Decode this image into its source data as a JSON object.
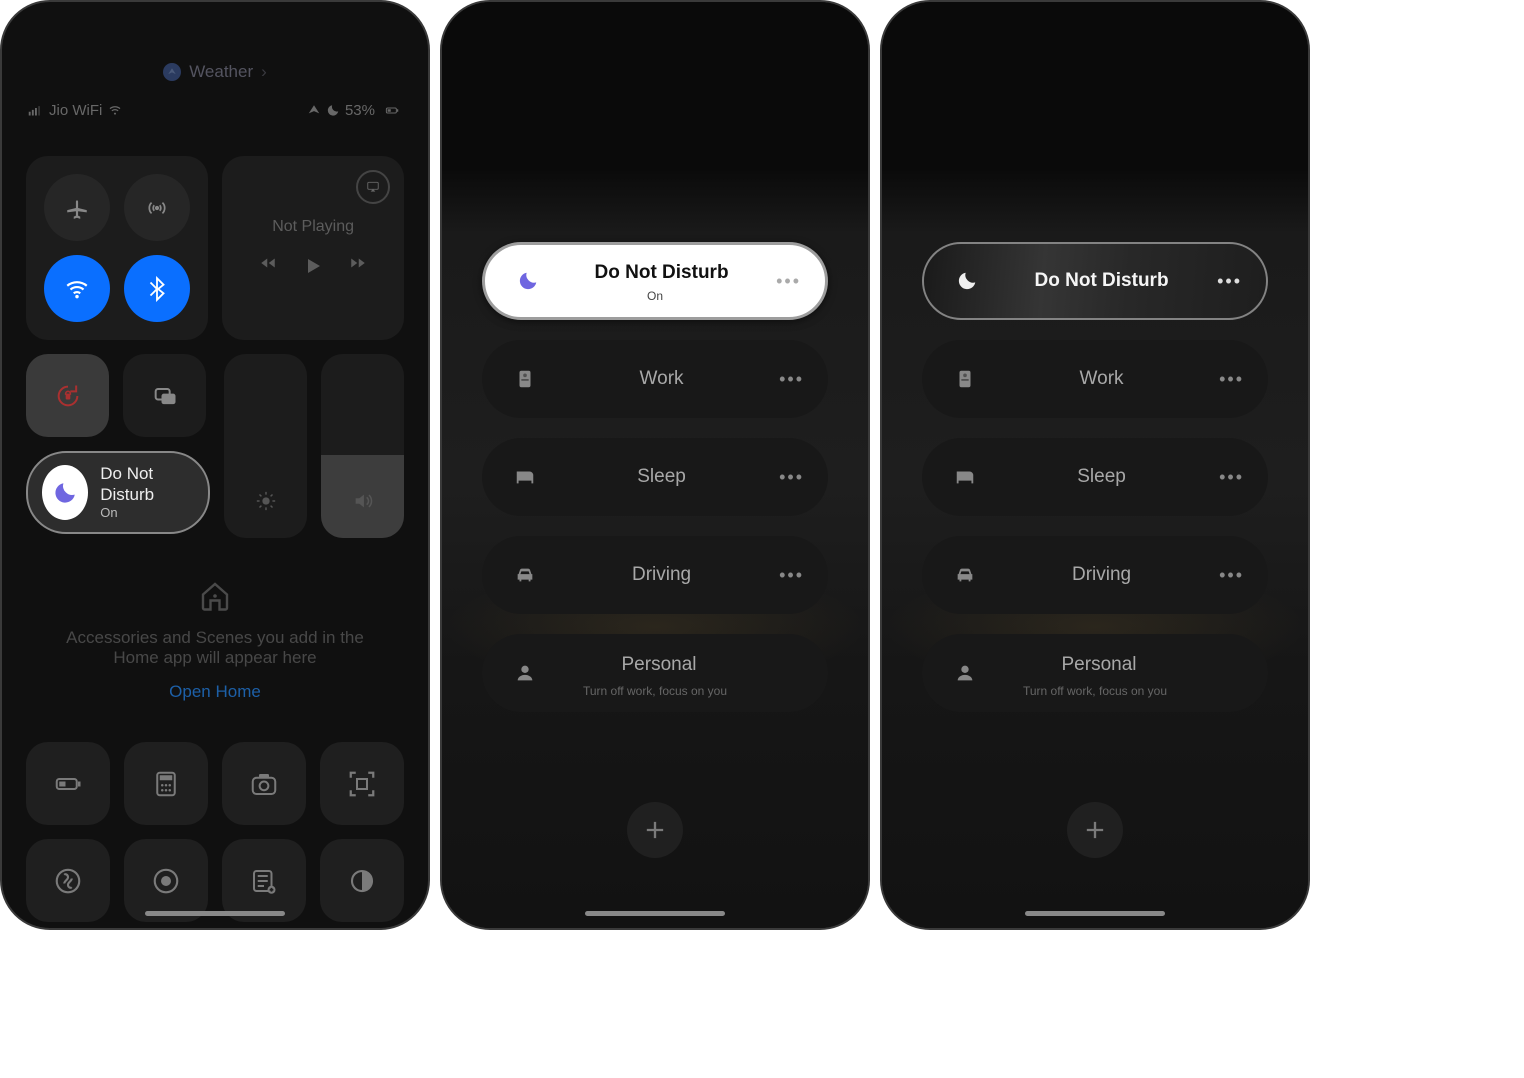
{
  "panel1": {
    "breadcrumb": {
      "label": "Weather"
    },
    "status": {
      "carrier": "Jio WiFi",
      "battery_percent": "53%"
    },
    "connectivity": {
      "airplane": false,
      "cellular": false,
      "wifi": true,
      "bluetooth": true
    },
    "now_playing": {
      "label": "Not Playing"
    },
    "orientation_lock": true,
    "focus_button": {
      "title": "Do Not Disturb",
      "status": "On"
    },
    "home": {
      "line1": "Accessories and Scenes you add in the",
      "line2": "Home app will appear here",
      "link": "Open Home"
    },
    "quick_tiles": [
      "low-power-icon",
      "calculator-icon",
      "camera-icon",
      "qr-scanner-icon",
      "shazam-icon",
      "screen-record-icon",
      "notes-icon",
      "dark-mode-icon"
    ]
  },
  "panel2": {
    "active_mode_state": "on",
    "modes": [
      {
        "id": "dnd",
        "label": "Do Not Disturb",
        "status": "On",
        "icon": "moon",
        "active": true
      },
      {
        "id": "work",
        "label": "Work",
        "icon": "badge",
        "active": false
      },
      {
        "id": "sleep",
        "label": "Sleep",
        "icon": "bed",
        "active": false
      },
      {
        "id": "driving",
        "label": "Driving",
        "icon": "car",
        "active": false
      },
      {
        "id": "personal",
        "label": "Personal",
        "sub": "Turn off work, focus on you",
        "icon": "person",
        "active": false
      }
    ]
  },
  "panel3": {
    "active_mode_state": "off",
    "modes": [
      {
        "id": "dnd",
        "label": "Do Not Disturb",
        "icon": "moon",
        "active": true
      },
      {
        "id": "work",
        "label": "Work",
        "icon": "badge",
        "active": false
      },
      {
        "id": "sleep",
        "label": "Sleep",
        "icon": "bed",
        "active": false
      },
      {
        "id": "driving",
        "label": "Driving",
        "icon": "car",
        "active": false
      },
      {
        "id": "personal",
        "label": "Personal",
        "sub": "Turn off work, focus on you",
        "icon": "person",
        "active": false
      }
    ]
  }
}
